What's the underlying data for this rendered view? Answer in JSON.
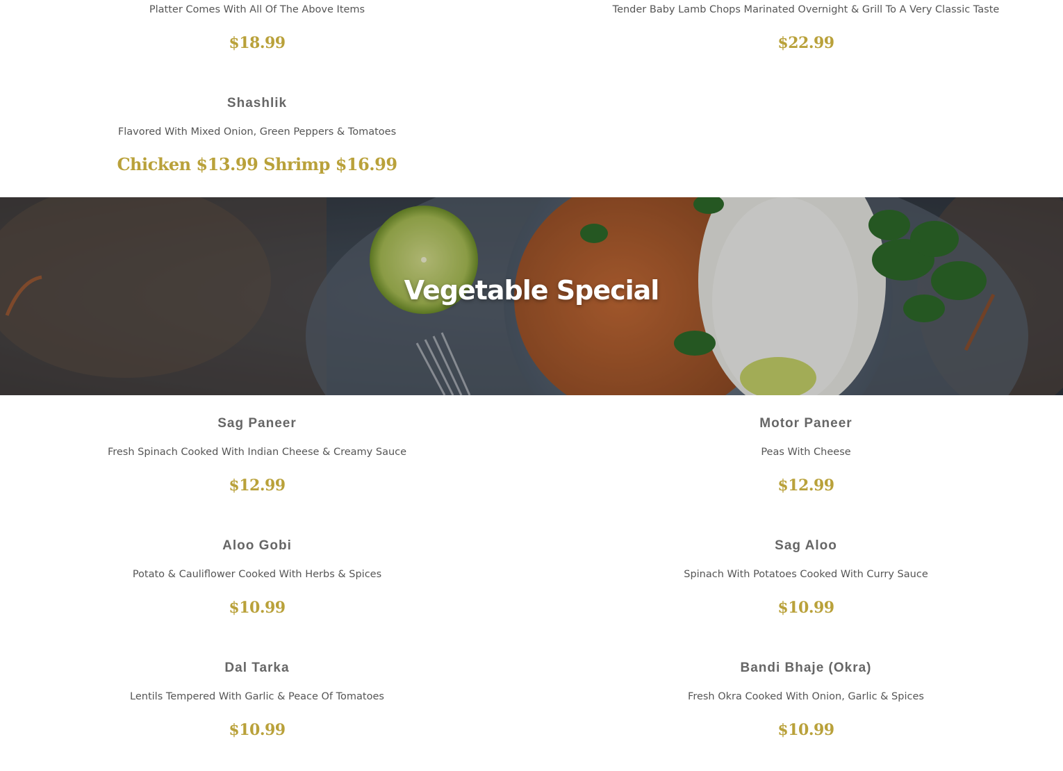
{
  "top_items": [
    {
      "description": "Platter Comes With All Of The Above Items",
      "price": "$18.99"
    },
    {
      "description": "Tender Baby Lamb Chops Marinated Overnight & Grill To A Very Classic Taste",
      "price": "$22.99"
    }
  ],
  "shashlik": {
    "name": "Shashlik",
    "description": "Flavored With Mixed Onion, Green Peppers & Tomatoes",
    "price": "Chicken $13.99 Shrimp $16.99"
  },
  "banner": {
    "title": "Vegetable Special"
  },
  "vegetable_items": [
    {
      "name": "Sag Paneer",
      "description": "Fresh Spinach Cooked With Indian Cheese & Creamy Sauce",
      "price": "$12.99"
    },
    {
      "name": "Motor Paneer",
      "description": "Peas With Cheese",
      "price": "$12.99"
    },
    {
      "name": "Aloo Gobi",
      "description": "Potato & Cauliflower Cooked With Herbs & Spices",
      "price": "$10.99"
    },
    {
      "name": "Sag Aloo",
      "description": "Spinach With Potatoes Cooked With Curry Sauce",
      "price": "$10.99"
    },
    {
      "name": "Dal Tarka",
      "description": "Lentils Tempered With Garlic & Peace Of Tomatoes",
      "price": "$10.99"
    },
    {
      "name": "Bandi Bhaje (Okra)",
      "description": "Fresh Okra Cooked With Onion, Garlic & Spices",
      "price": "$10.99"
    }
  ],
  "colors": {
    "price": "#b9a13a",
    "item_name": "#666666",
    "description": "#555555",
    "banner_text": "#ffffff"
  }
}
